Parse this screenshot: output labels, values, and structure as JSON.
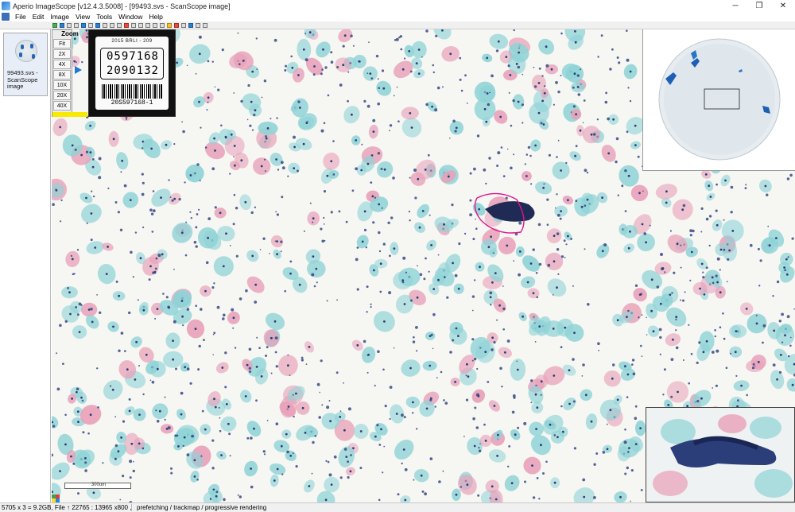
{
  "window": {
    "title": "Aperio ImageScope [v12.4.3.5008] - [99493.svs - ScanScope image]",
    "controls": [
      "─",
      "❐",
      "✕"
    ]
  },
  "menu": {
    "items": [
      "File",
      "Edit",
      "Image",
      "View",
      "Tools",
      "Window",
      "Help"
    ]
  },
  "sidebar": {
    "thumbnail_label": "99493.svs - ScanScope image"
  },
  "zoom_panel": {
    "title": "Zoom",
    "levels": [
      "Fit",
      "2X",
      "4X",
      "8X",
      "10X",
      "20X",
      "40X"
    ],
    "selected": "8X"
  },
  "slide_label": {
    "header": "2015 BRLI - 209",
    "line1": "0597168",
    "line2": "2090132",
    "barcode_text": "20S597168-1"
  },
  "scale_bar": {
    "label": "300um"
  },
  "status": {
    "dimensions": "5705 x 3 = 9.2GB, File ↑ 22765 : 13965 x800 , 2625",
    "message": "prefetching / trackmap / progressive rendering"
  },
  "colors": {
    "cell_teal": "#8fd3d6",
    "cell_pink": "#e8a0b8",
    "nucleus_blue": "#2c3e7a",
    "annotation_magenta": "#e0148c"
  }
}
